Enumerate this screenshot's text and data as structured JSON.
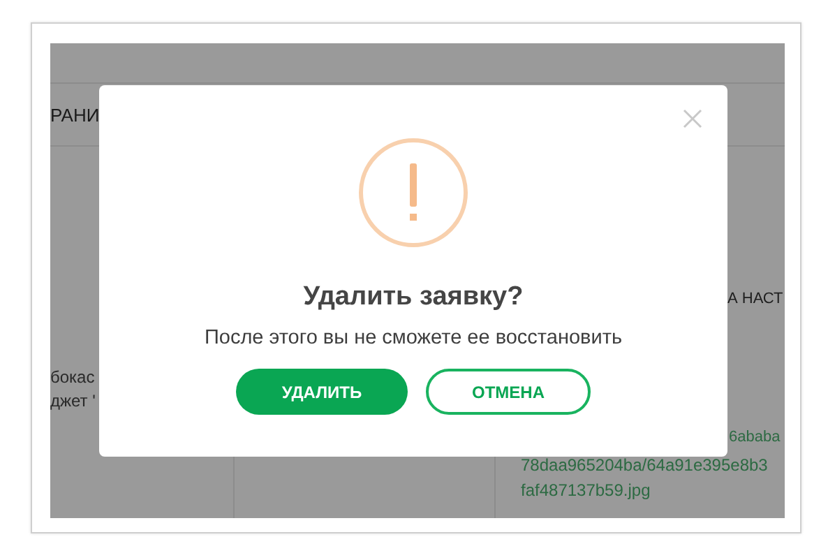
{
  "background_page": {
    "header_cell": "РАНИ",
    "column_1_lines": [
      "бокас",
      "джет '"
    ],
    "column_3_text": "А НАСТ",
    "link_lines": [
      "6ababa",
      "78daa965204ba/64a91e395e8b3",
      "faf487137b59.jpg"
    ]
  },
  "dialog": {
    "title": "Удалить заявку?",
    "message": "После этого вы не сможете ее восстановить",
    "buttons": [
      {
        "label": "УДАЛИТЬ",
        "kind": "primary"
      },
      {
        "label": "ОТМЕНА",
        "kind": "secondary"
      }
    ]
  }
}
